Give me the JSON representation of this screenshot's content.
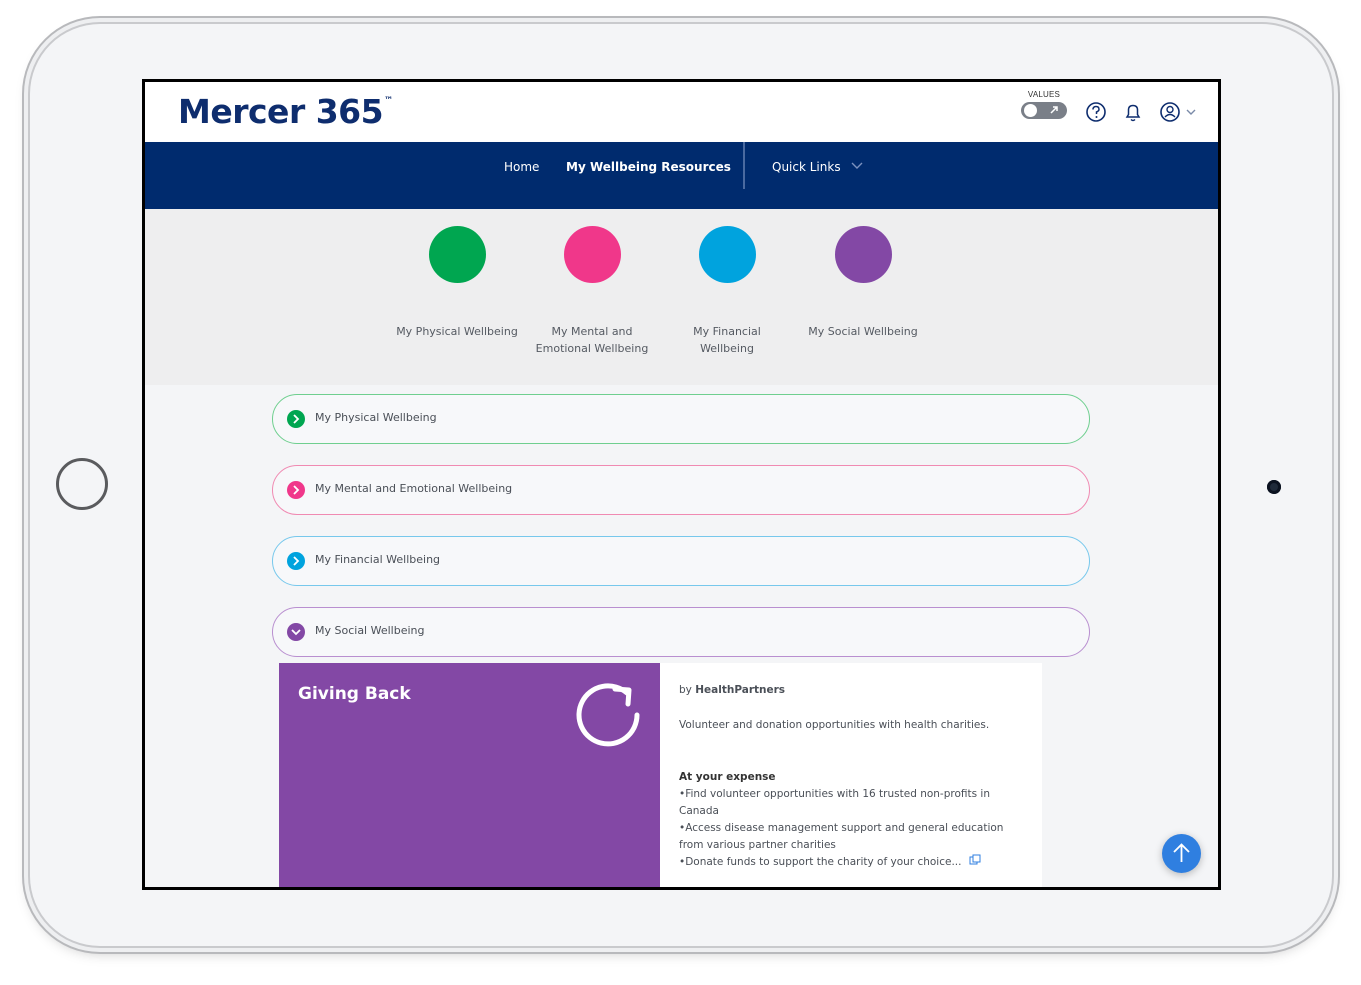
{
  "header": {
    "logo_text": "Mercer 365",
    "logo_tm": "™",
    "values_label": "VALUES"
  },
  "nav": {
    "home": "Home",
    "wellbeing": "My Wellbeing Resources",
    "quick_links": "Quick Links"
  },
  "categories": [
    {
      "label_l1": "My Physical Wellbeing",
      "label_l2": "",
      "color": "#00a650"
    },
    {
      "label_l1": "My Mental and",
      "label_l2": "Emotional Wellbeing",
      "color": "#f0378a"
    },
    {
      "label_l1": "My Financial",
      "label_l2": "Wellbeing",
      "color": "#00a3de"
    },
    {
      "label_l1": "My Social Wellbeing",
      "label_l2": "",
      "color": "#8348a5"
    }
  ],
  "accordions": [
    {
      "label": "My Physical Wellbeing",
      "color": "#00a650",
      "border": "#6fcf8f"
    },
    {
      "label": "My Mental and Emotional Wellbeing",
      "color": "#f0378a",
      "border": "#f08ab2"
    },
    {
      "label": "My Financial Wellbeing",
      "color": "#00a3de",
      "border": "#77c8ec"
    },
    {
      "label": "My Social Wellbeing",
      "color": "#8348a5",
      "border": "#b98fd0"
    }
  ],
  "card": {
    "title": "Giving Back",
    "by_prefix": "by",
    "provider": "HealthPartners",
    "description": "Volunteer and donation opportunities with health charities.",
    "section_heading": "At your expense",
    "bullets": [
      "•Find volunteer opportunities with 16 trusted non-profits in",
      "Canada",
      "•Access disease management support and general education",
      "from various partner charities",
      "•Donate funds to support the charity of your choice..."
    ]
  }
}
